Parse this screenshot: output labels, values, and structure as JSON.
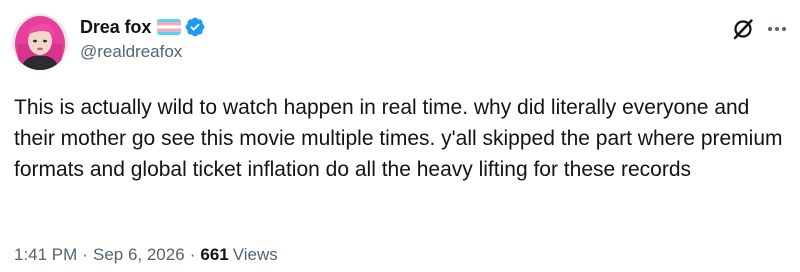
{
  "author": {
    "display_name": "Drea fox",
    "handle": "@realdreafox",
    "flag_icon": "transgender-flag",
    "verified_icon": "verified-badge",
    "verified_color": "#1d9bf0"
  },
  "actions": {
    "grok_icon": "grok-icon",
    "more_icon": "more-icon"
  },
  "tweet": {
    "text": "This is actually wild to watch happen in real time. why did literally everyone and their mother go see this movie multiple times. y'all skipped the part where premium formats and global ticket inflation do all the heavy lifting for these records"
  },
  "meta": {
    "time": "1:41 PM",
    "separator": "·",
    "date": "Sep 6, 2026",
    "views_count": "661",
    "views_label": "Views"
  },
  "colors": {
    "text": "#0f1419",
    "secondary": "#536471",
    "flag_blue": "#5bcefa",
    "flag_pink": "#f5a9b8"
  }
}
